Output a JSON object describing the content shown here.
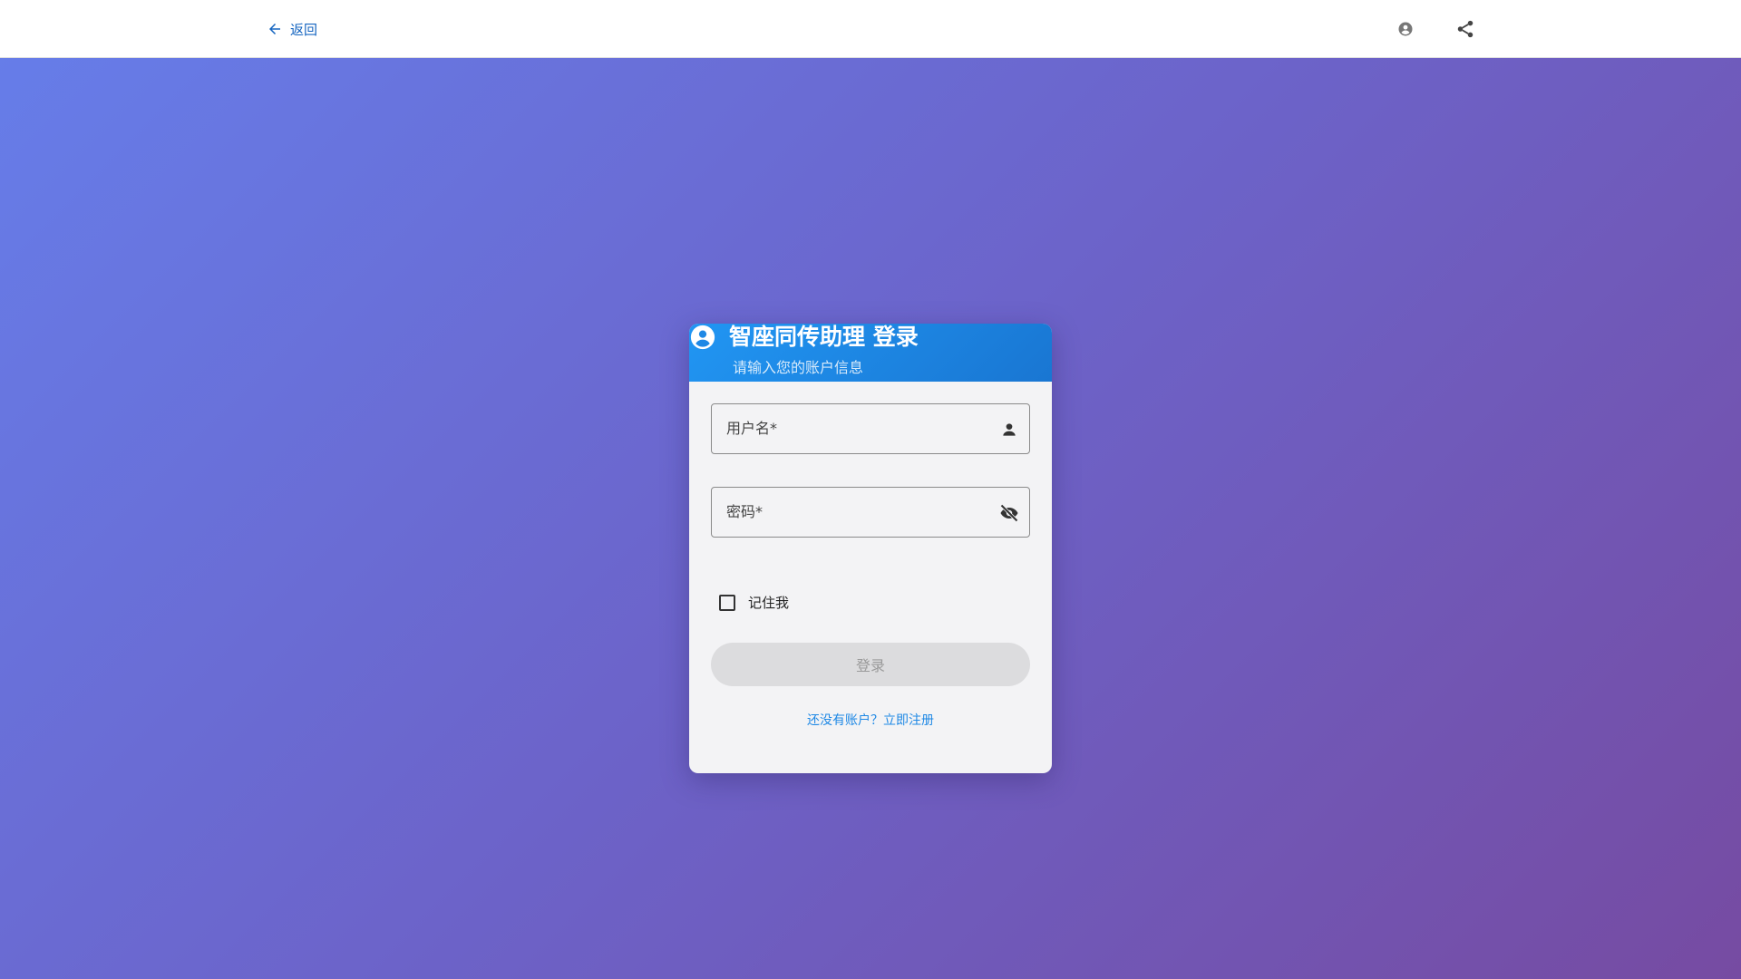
{
  "topbar": {
    "back_label": "返回",
    "icons": [
      "arrow-left-icon",
      "account-circle-icon",
      "share-icon"
    ]
  },
  "login_card": {
    "title": "智座同传助理 登录",
    "subtitle": "请输入您的账户信息",
    "username": {
      "label": "用户名*",
      "value": "",
      "icon": "person-icon"
    },
    "password": {
      "label": "密码*",
      "value": "",
      "icon": "eye-off-icon"
    },
    "remember_me": {
      "label": "记住我",
      "checked": false
    },
    "login_button": "登录",
    "register_link": "还没有账户？立即注册"
  },
  "colors": {
    "primary": "#1e88e5",
    "header_gradient_start": "#2196f3",
    "header_gradient_end": "#1976d2",
    "background_gradient_start": "#667eea",
    "background_gradient_end": "#764ba2",
    "disabled_button": "#dcdcde"
  }
}
